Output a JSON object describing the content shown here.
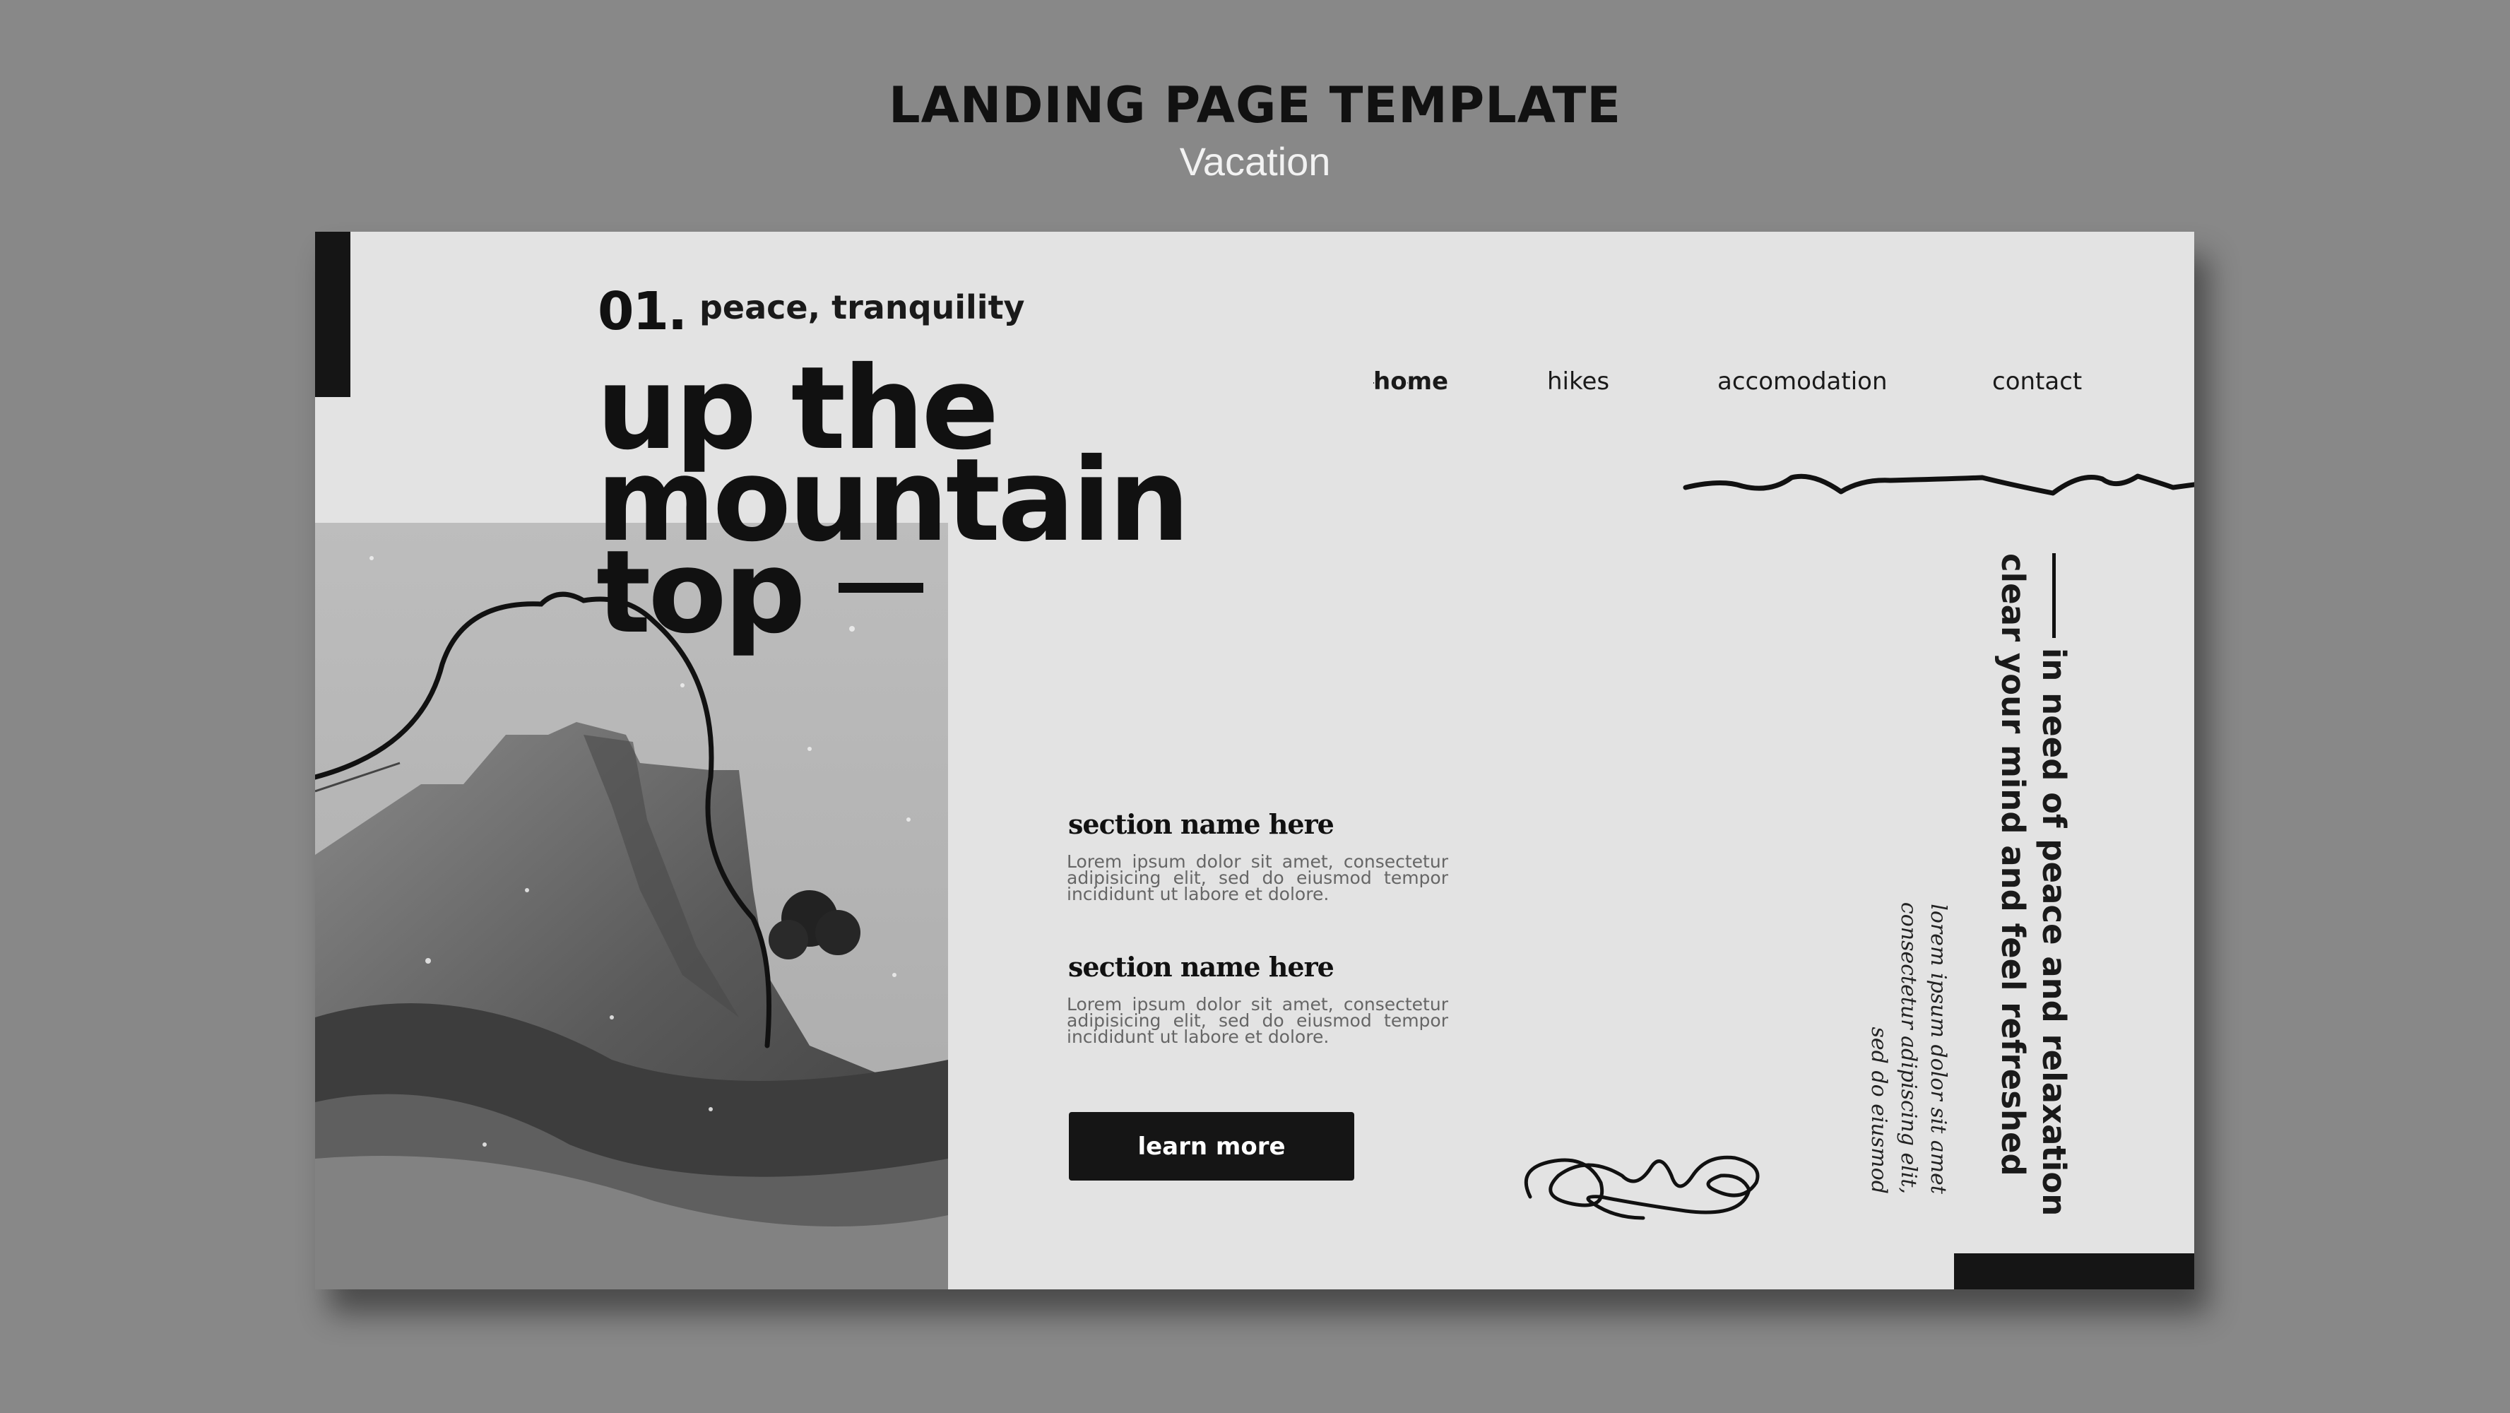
{
  "header": {
    "title": "LANDING PAGE TEMPLATE",
    "subtitle": "Vacation"
  },
  "hero": {
    "number": "01.",
    "tagline": "peace, tranquility",
    "headline_lines": [
      "up the",
      "mountain",
      "top"
    ]
  },
  "nav": {
    "items": [
      "home",
      "hikes",
      "accomodation",
      "contact"
    ],
    "active": "home"
  },
  "sections": [
    {
      "title": "section name here",
      "text": "Lorem ipsum dolor sit amet, consectetur adipisicing elit, sed do eiusmod tempor incididunt ut labore et dolore."
    },
    {
      "title": "section name here",
      "text": "Lorem ipsum dolor sit amet, consectetur adipisicing elit, sed do eiusmod tempor incididunt ut labore et dolore."
    }
  ],
  "cta": {
    "label": "learn more"
  },
  "vertical_text": {
    "line1": "in need of peace and relaxation",
    "line2": "clear your mind and feel refreshed"
  },
  "script_text": {
    "line1": "lorem ipsum dolor sit amet",
    "line2": "consectetur adipiscing elit,",
    "line3": "sed do eiusmod"
  },
  "colors": {
    "background": "#888888",
    "page": "#e3e3e3",
    "ink": "#111111",
    "button": "#151515"
  }
}
